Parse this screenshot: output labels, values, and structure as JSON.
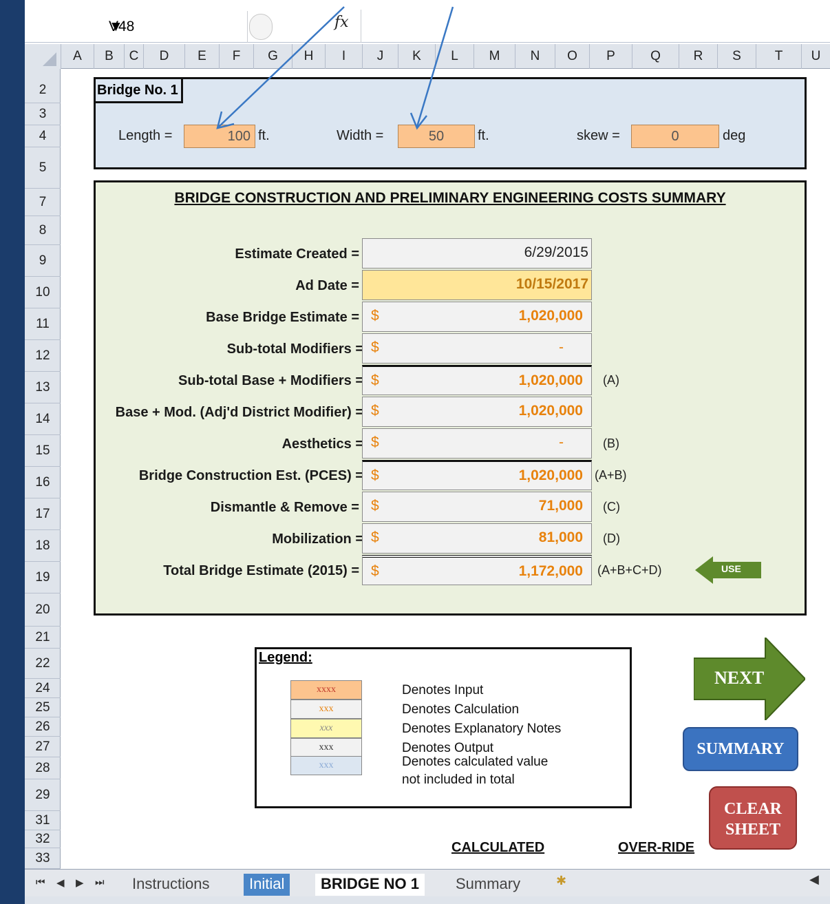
{
  "formula_bar": {
    "name_box": "V48",
    "fx_label": "fx"
  },
  "columns": [
    "A",
    "B",
    "C",
    "D",
    "E",
    "F",
    "G",
    "H",
    "I",
    "J",
    "K",
    "L",
    "M",
    "N",
    "O",
    "P",
    "Q",
    "R",
    "S",
    "T",
    "U"
  ],
  "rows": [
    "2",
    "3",
    "4",
    "5",
    "7",
    "8",
    "9",
    "10",
    "11",
    "12",
    "13",
    "14",
    "15",
    "16",
    "17",
    "18",
    "19",
    "20",
    "21",
    "22",
    "24",
    "25",
    "26",
    "27",
    "28",
    "29",
    "31",
    "32",
    "33"
  ],
  "bridge": {
    "title": "Bridge No.  1",
    "length_label": "Length =",
    "length_value": "100",
    "length_unit": "ft.",
    "width_label": "Width =",
    "width_value": "50",
    "width_unit": "ft.",
    "skew_label": "skew =",
    "skew_value": "0",
    "skew_unit": "deg"
  },
  "summary": {
    "title": "BRIDGE CONSTRUCTION AND PRELIMINARY ENGINEERING COSTS SUMMARY",
    "estimate_created": {
      "label": "Estimate Created =",
      "value": "6/29/2015"
    },
    "ad_date": {
      "label": "Ad Date =",
      "value": "10/15/2017"
    },
    "lines": [
      {
        "label": "Base Bridge Estimate =",
        "currency": "$",
        "value": "1,020,000",
        "note": ""
      },
      {
        "label": "Sub-total Modifiers =",
        "currency": "$",
        "value": "-",
        "note": ""
      },
      {
        "label": "Sub-total Base + Modifiers =",
        "currency": "$",
        "value": "1,020,000",
        "note": "(A)"
      },
      {
        "label": "Base + Mod. (Adj'd District Modifier) =",
        "currency": "$",
        "value": "1,020,000",
        "note": ""
      },
      {
        "label": "Aesthetics =",
        "currency": "$",
        "value": "-",
        "note": "(B)"
      },
      {
        "label": "Bridge Construction Est. (PCES) =",
        "currency": "$",
        "value": "1,020,000",
        "note": "(A+B)"
      },
      {
        "label": "Dismantle & Remove =",
        "currency": "$",
        "value": "71,000",
        "note": "(C)"
      },
      {
        "label": "Mobilization =",
        "currency": "$",
        "value": "81,000",
        "note": "(D)"
      },
      {
        "label": "Total Bridge Estimate (2015)  =",
        "currency": "$",
        "value": "1,172,000",
        "note": "(A+B+C+D)"
      }
    ],
    "use_label": "USE"
  },
  "legend": {
    "title": "Legend:",
    "items": [
      {
        "swatch": "xxxx",
        "text": "Denotes Input",
        "bg": "#fcc48e",
        "fg": "#c0392b"
      },
      {
        "swatch": "xxx",
        "text": "Denotes Calculation",
        "bg": "#f2f2f2",
        "fg": "#e8820c"
      },
      {
        "swatch": "xxx",
        "text": "Denotes Explanatory Notes",
        "bg": "#fff9b0",
        "fg": "#888888"
      },
      {
        "swatch": "xxx",
        "text": "Denotes Output",
        "bg": "#f2f2f2",
        "fg": "#333333"
      },
      {
        "swatch": "xxx",
        "text": "Denotes calculated value",
        "bg": "#dce6f1",
        "fg": "#8aaad6"
      }
    ],
    "extra_line": "not included in total"
  },
  "buttons": {
    "next": "NEXT",
    "summary": "SUMMARY",
    "clear_line1": "CLEAR",
    "clear_line2": "SHEET"
  },
  "headers": {
    "calculated": "CALCULATED",
    "override": "OVER-RIDE"
  },
  "tabs": [
    "Instructions",
    "Initial",
    "BRIDGE NO 1",
    "Summary"
  ],
  "colors": {
    "input": "#fcc48e",
    "calc": "#e8820c",
    "panel": "#ebf1de",
    "top_panel": "#dce6f1",
    "next_green": "#5e8a2c",
    "summary_blue": "#3b73c0",
    "clear_red": "#c0504d",
    "arrow_blue": "#3a78c4"
  }
}
